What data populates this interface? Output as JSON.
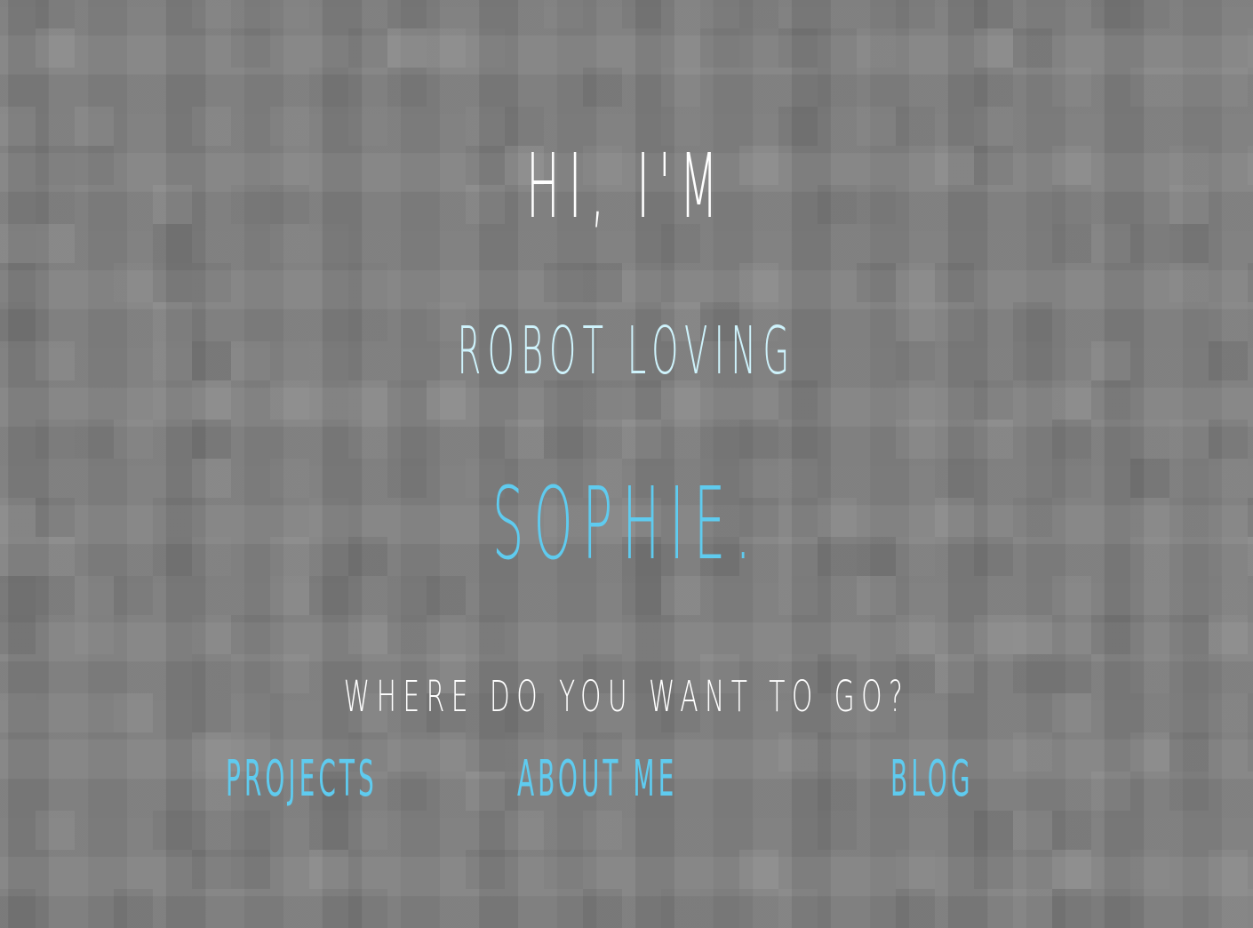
{
  "greeting": "HI, I'M",
  "descriptor": "ROBOT LOVING",
  "name": "SOPHIE.",
  "prompt": "WHERE DO YOU WANT TO GO?",
  "nav": {
    "projects": "PROJECTS",
    "about": "ABOUT ME",
    "blog": "BLOG"
  },
  "colors": {
    "background": "#7d7d7d",
    "greeting": "#ffffff",
    "descriptor": "#cef3fc",
    "accent": "#5fcbef"
  }
}
